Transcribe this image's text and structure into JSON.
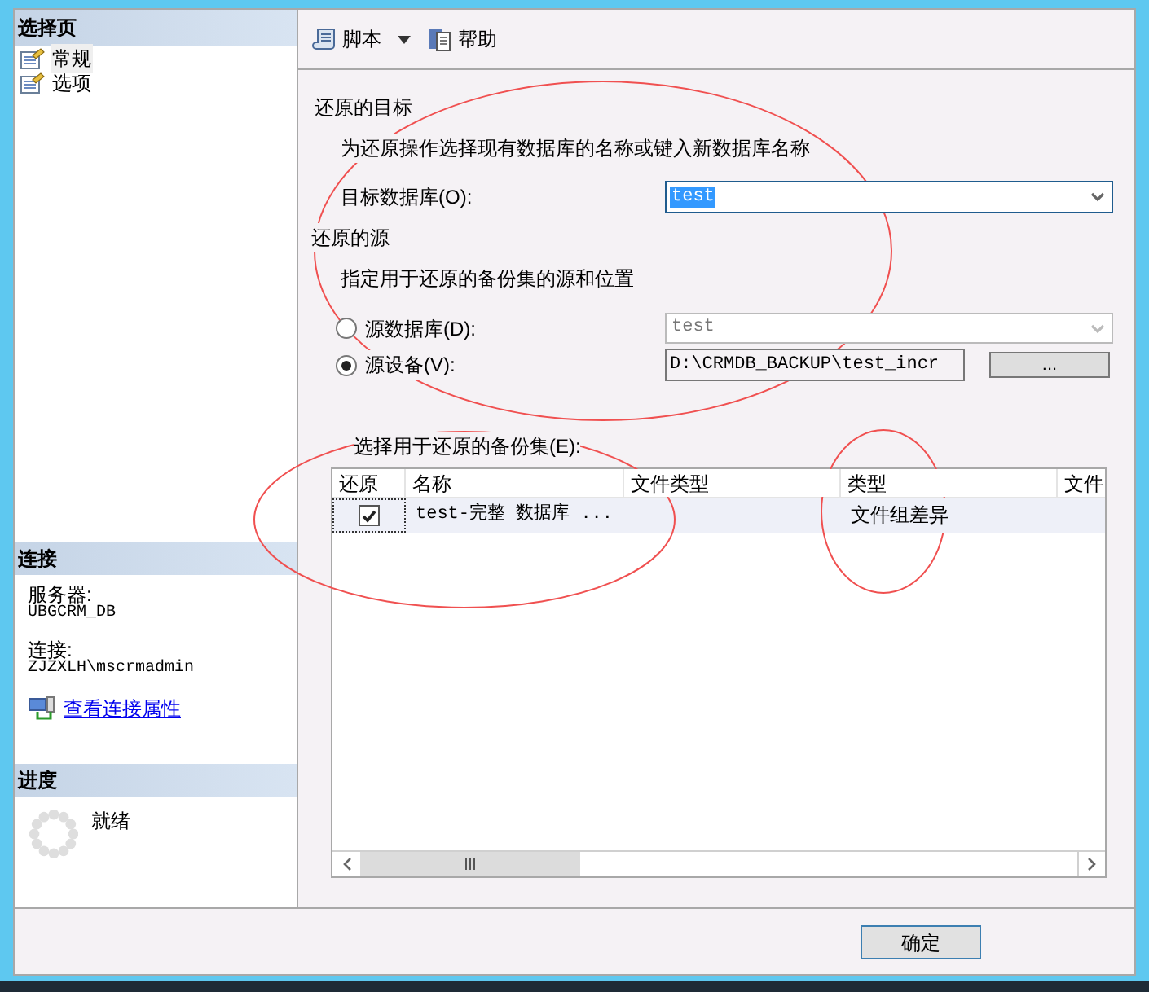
{
  "sidebar": {
    "header": "选择页",
    "pages": [
      {
        "label": "常规",
        "selected": true
      },
      {
        "label": "选项",
        "selected": false
      }
    ]
  },
  "connection": {
    "header": "连接",
    "server_label": "服务器:",
    "server": "UBGCRM_DB",
    "connection_label": "连接:",
    "connection": "ZJZXLH\\mscrmadmin",
    "link": "查看连接属性"
  },
  "progress": {
    "header": "进度",
    "status": "就绪"
  },
  "toolbar": [
    {
      "label": "脚本",
      "kind": "dropdown"
    },
    {
      "label": "帮助",
      "kind": "button"
    }
  ],
  "destination": {
    "heading": "还原的目标",
    "description": "为还原操作选择现有数据库的名称或键入新数据库名称",
    "database_label": "目标数据库(O):",
    "database": "test"
  },
  "source": {
    "heading": "还原的源",
    "description": "指定用于还原的备份集的源和位置",
    "options": [
      {
        "label": "源数据库(D):",
        "selected": false,
        "value": "test",
        "kind": "dropdown"
      },
      {
        "label": "源设备(V):",
        "selected": true,
        "value": "D:\\CRMDB_BACKUP\\test_incr",
        "kind": "path"
      }
    ],
    "browse": "..."
  },
  "backup_sets": {
    "label": "选择用于还原的备份集(E):",
    "columns": [
      "还原",
      "名称",
      "文件类型",
      "类型",
      "文件"
    ],
    "rows": [
      {
        "restore": true,
        "name": "test-完整 数据库 ...",
        "type": "文件组差异"
      }
    ]
  },
  "buttons": [
    "确定"
  ]
}
